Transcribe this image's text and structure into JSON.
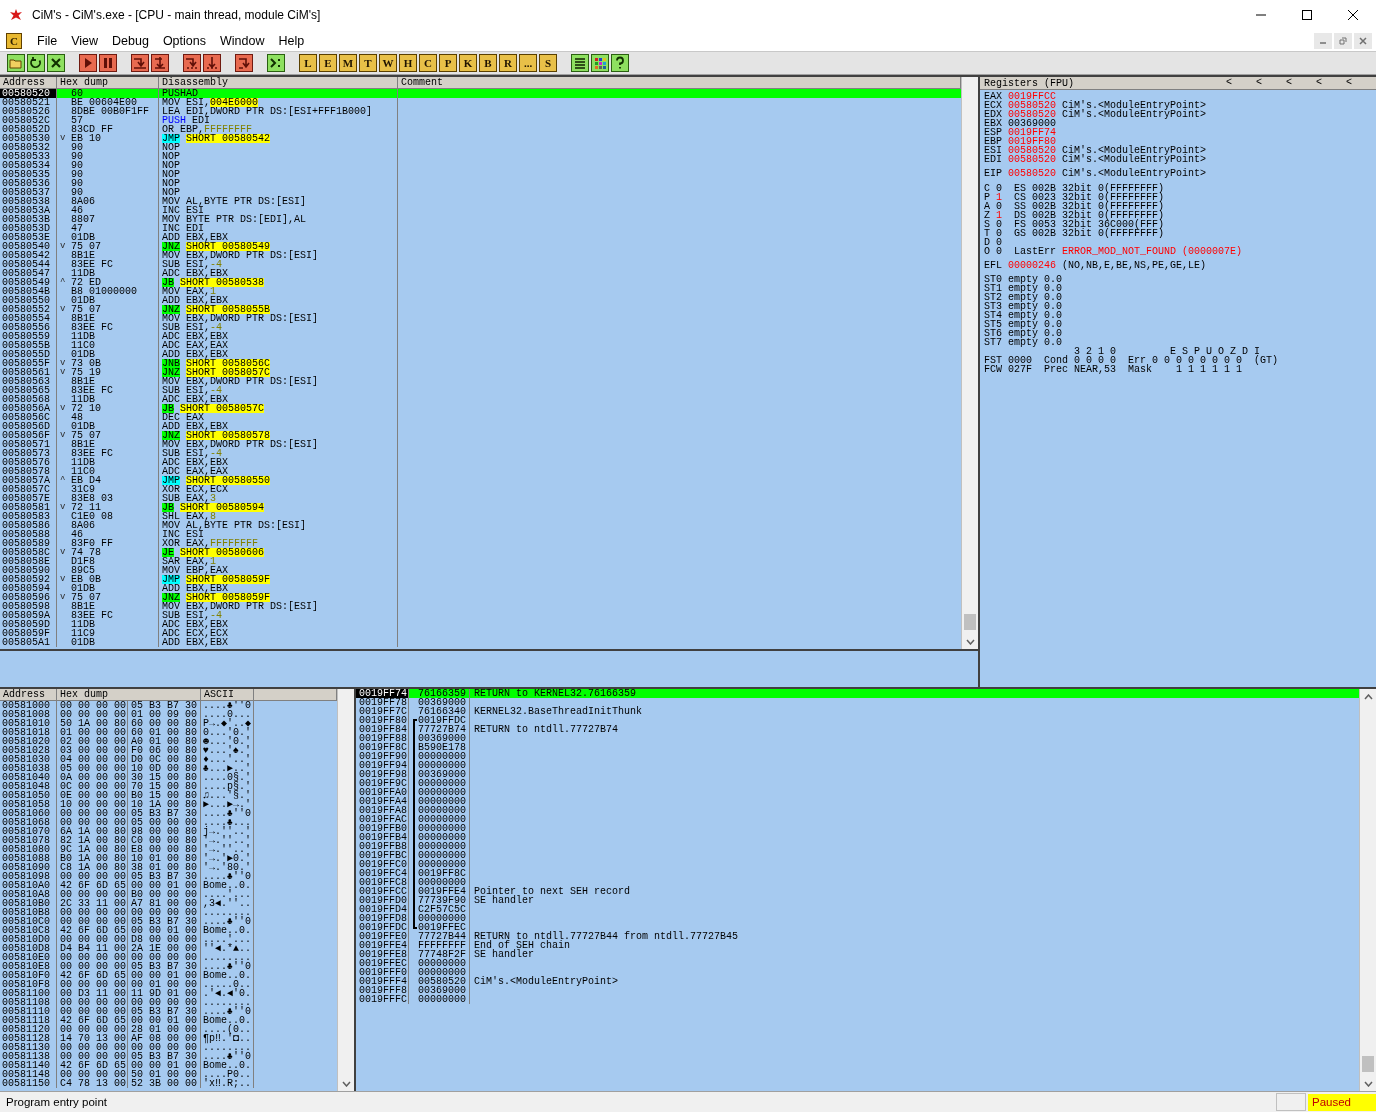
{
  "window": {
    "title": "CiM's - CiM's.exe - [CPU - main thread, module CiM's]"
  },
  "menu": {
    "app_letter": "C",
    "items": [
      "File",
      "View",
      "Debug",
      "Options",
      "Window",
      "Help"
    ]
  },
  "toolbar": {
    "window_buttons": [
      "L",
      "E",
      "M",
      "T",
      "W",
      "H",
      "C",
      "P",
      "K",
      "B",
      "R",
      "...",
      "S"
    ]
  },
  "disassembly": {
    "columns": [
      "Address",
      "Hex dump",
      "Disassembly",
      "Comment"
    ],
    "rows": [
      {
        "kind": "plain",
        "address": "00580520",
        "hex": "60",
        "op": "PUSHAD",
        "selected": true
      },
      {
        "kind": "plain",
        "address": "00580521",
        "hex": "BE 00604E00",
        "op": "MOV",
        "operands": "ESI,",
        "value": {
          "text": "004E6000",
          "kind": "address"
        },
        "selected": false
      },
      {
        "kind": "plain",
        "address": "00580526",
        "hex": "8DBE 00B0F1FF",
        "op": "LEA",
        "operands": "EDI,DWORD PTR DS:[ESI+FFF1B000]",
        "selected": false
      },
      {
        "kind": "push",
        "address": "0058052C",
        "hex": "57",
        "op": "PUSH",
        "operands": "EDI",
        "selected": false
      },
      {
        "kind": "plain",
        "address": "0058052D",
        "hex": "83CD FF",
        "op": "OR",
        "operands": "EBP,",
        "value": {
          "text": "FFFFFFFF",
          "kind": "constant"
        },
        "selected": false
      },
      {
        "kind": "jump",
        "address": "00580530",
        "arrow": "v",
        "hex": "EB 10",
        "op": "JMP",
        "value": {
          "text": "SHORT 00580542",
          "kind": "target"
        },
        "selected": false
      },
      {
        "kind": "plain",
        "address": "00580532",
        "hex": "90",
        "op": "NOP",
        "selected": false
      },
      {
        "kind": "plain",
        "address": "00580533",
        "hex": "90",
        "op": "NOP",
        "selected": false
      },
      {
        "kind": "plain",
        "address": "00580534",
        "hex": "90",
        "op": "NOP",
        "selected": false
      },
      {
        "kind": "plain",
        "address": "00580535",
        "hex": "90",
        "op": "NOP",
        "selected": false
      },
      {
        "kind": "plain",
        "address": "00580536",
        "hex": "90",
        "op": "NOP",
        "selected": false
      },
      {
        "kind": "plain",
        "address": "00580537",
        "hex": "90",
        "op": "NOP",
        "selected": false
      },
      {
        "kind": "plain",
        "address": "00580538",
        "hex": "8A06",
        "op": "MOV",
        "operands": "AL,BYTE PTR DS:[ESI]",
        "selected": false
      },
      {
        "kind": "plain",
        "address": "0058053A",
        "hex": "46",
        "op": "INC",
        "operands": "ESI",
        "selected": false
      },
      {
        "kind": "plain",
        "address": "0058053B",
        "hex": "8807",
        "op": "MOV",
        "operands": "BYTE PTR DS:[EDI],AL",
        "selected": false
      },
      {
        "kind": "plain",
        "address": "0058053D",
        "hex": "47",
        "op": "INC",
        "operands": "EDI",
        "selected": false
      },
      {
        "kind": "plain",
        "address": "0058053E",
        "hex": "01DB",
        "op": "ADD",
        "operands": "EBX,EBX",
        "selected": false
      },
      {
        "kind": "branch",
        "address": "00580540",
        "arrow": "v",
        "hex": "75 07",
        "op": "JNZ",
        "value": {
          "text": "SHORT 00580549",
          "kind": "target"
        },
        "selected": false
      },
      {
        "kind": "plain",
        "address": "00580542",
        "hex": "8B1E",
        "op": "MOV",
        "operands": "EBX,DWORD PTR DS:[ESI]",
        "selected": false
      },
      {
        "kind": "plain",
        "address": "00580544",
        "hex": "83EE FC",
        "op": "SUB",
        "operands": "ESI,",
        "value": {
          "text": "-4",
          "kind": "constant"
        },
        "selected": false
      },
      {
        "kind": "plain",
        "address": "00580547",
        "hex": "11DB",
        "op": "ADC",
        "operands": "EBX,EBX",
        "selected": false
      },
      {
        "kind": "branch",
        "address": "00580549",
        "arrow": "^",
        "hex": "72 ED",
        "op": "JB",
        "value": {
          "text": "SHORT 00580538",
          "kind": "target"
        },
        "selected": false
      },
      {
        "kind": "plain",
        "address": "0058054B",
        "hex": "B8 01000000",
        "op": "MOV",
        "operands": "EAX,",
        "value": {
          "text": "1",
          "kind": "constant"
        },
        "selected": false
      },
      {
        "kind": "plain",
        "address": "00580550",
        "hex": "01DB",
        "op": "ADD",
        "operands": "EBX,EBX",
        "selected": false
      },
      {
        "kind": "branch",
        "address": "00580552",
        "arrow": "v",
        "hex": "75 07",
        "op": "JNZ",
        "value": {
          "text": "SHORT 0058055B",
          "kind": "target"
        },
        "selected": false
      },
      {
        "kind": "plain",
        "address": "00580554",
        "hex": "8B1E",
        "op": "MOV",
        "operands": "EBX,DWORD PTR DS:[ESI]",
        "selected": false
      },
      {
        "kind": "plain",
        "address": "00580556",
        "hex": "83EE FC",
        "op": "SUB",
        "operands": "ESI,",
        "value": {
          "text": "-4",
          "kind": "constant"
        },
        "selected": false
      },
      {
        "kind": "plain",
        "address": "00580559",
        "hex": "11DB",
        "op": "ADC",
        "operands": "EBX,EBX",
        "selected": false
      },
      {
        "kind": "plain",
        "address": "0058055B",
        "hex": "11C0",
        "op": "ADC",
        "operands": "EAX,EAX",
        "selected": false
      },
      {
        "kind": "plain",
        "address": "0058055D",
        "hex": "01DB",
        "op": "ADD",
        "operands": "EBX,EBX",
        "selected": false
      },
      {
        "kind": "branch",
        "address": "0058055F",
        "arrow": "v",
        "hex": "73 0B",
        "op": "JNB",
        "value": {
          "text": "SHORT 0058056C",
          "kind": "target"
        },
        "selected": false
      },
      {
        "kind": "branch",
        "address": "00580561",
        "arrow": "v",
        "hex": "75 19",
        "op": "JNZ",
        "value": {
          "text": "SHORT 0058057C",
          "kind": "target"
        },
        "selected": false
      },
      {
        "kind": "plain",
        "address": "00580563",
        "hex": "8B1E",
        "op": "MOV",
        "operands": "EBX,DWORD PTR DS:[ESI]",
        "selected": false
      },
      {
        "kind": "plain",
        "address": "00580565",
        "hex": "83EE FC",
        "op": "SUB",
        "operands": "ESI,",
        "value": {
          "text": "-4",
          "kind": "constant"
        },
        "selected": false
      },
      {
        "kind": "plain",
        "address": "00580568",
        "hex": "11DB",
        "op": "ADC",
        "operands": "EBX,EBX",
        "selected": false
      },
      {
        "kind": "branch",
        "address": "0058056A",
        "arrow": "v",
        "hex": "72 10",
        "op": "JB",
        "value": {
          "text": "SHORT 0058057C",
          "kind": "target"
        },
        "selected": false
      },
      {
        "kind": "plain",
        "address": "0058056C",
        "hex": "48",
        "op": "DEC",
        "operands": "EAX",
        "selected": false
      },
      {
        "kind": "plain",
        "address": "0058056D",
        "hex": "01DB",
        "op": "ADD",
        "operands": "EBX,EBX",
        "selected": false
      },
      {
        "kind": "branch",
        "address": "0058056F",
        "arrow": "v",
        "hex": "75 07",
        "op": "JNZ",
        "value": {
          "text": "SHORT 00580578",
          "kind": "target"
        },
        "selected": false
      },
      {
        "kind": "plain",
        "address": "00580571",
        "hex": "8B1E",
        "op": "MOV",
        "operands": "EBX,DWORD PTR DS:[ESI]",
        "selected": false
      },
      {
        "kind": "plain",
        "address": "00580573",
        "hex": "83EE FC",
        "op": "SUB",
        "operands": "ESI,",
        "value": {
          "text": "-4",
          "kind": "constant"
        },
        "selected": false
      },
      {
        "kind": "plain",
        "address": "00580576",
        "hex": "11DB",
        "op": "ADC",
        "operands": "EBX,EBX",
        "selected": false
      },
      {
        "kind": "plain",
        "address": "00580578",
        "hex": "11C0",
        "op": "ADC",
        "operands": "EAX,EAX",
        "selected": false
      },
      {
        "kind": "jump",
        "address": "0058057A",
        "arrow": "^",
        "hex": "EB D4",
        "op": "JMP",
        "value": {
          "text": "SHORT 00580550",
          "kind": "target"
        },
        "selected": false
      },
      {
        "kind": "plain",
        "address": "0058057C",
        "hex": "31C9",
        "op": "XOR",
        "operands": "ECX,ECX",
        "selected": false
      },
      {
        "kind": "plain",
        "address": "0058057E",
        "hex": "83E8 03",
        "op": "SUB",
        "operands": "EAX,",
        "value": {
          "text": "3",
          "kind": "constant"
        },
        "selected": false
      },
      {
        "kind": "branch",
        "address": "00580581",
        "arrow": "v",
        "hex": "72 11",
        "op": "JB",
        "value": {
          "text": "SHORT 00580594",
          "kind": "target"
        },
        "selected": false
      },
      {
        "kind": "plain",
        "address": "00580583",
        "hex": "C1E0 08",
        "op": "SHL",
        "operands": "EAX,",
        "value": {
          "text": "8",
          "kind": "constant"
        },
        "selected": false
      },
      {
        "kind": "plain",
        "address": "00580586",
        "hex": "8A06",
        "op": "MOV",
        "operands": "AL,BYTE PTR DS:[ESI]",
        "selected": false
      },
      {
        "kind": "plain",
        "address": "00580588",
        "hex": "46",
        "op": "INC",
        "operands": "ESI",
        "selected": false
      },
      {
        "kind": "plain",
        "address": "00580589",
        "hex": "83F0 FF",
        "op": "XOR",
        "operands": "EAX,",
        "value": {
          "text": "FFFFFFFF",
          "kind": "constant"
        },
        "selected": false
      },
      {
        "kind": "branch",
        "address": "0058058C",
        "arrow": "v",
        "hex": "74 78",
        "op": "JE",
        "value": {
          "text": "SHORT 00580606",
          "kind": "target"
        },
        "selected": false
      },
      {
        "kind": "plain",
        "address": "0058058E",
        "hex": "D1F8",
        "op": "SAR",
        "operands": "EAX,",
        "value": {
          "text": "1",
          "kind": "constant"
        },
        "selected": false
      },
      {
        "kind": "plain",
        "address": "00580590",
        "hex": "89C5",
        "op": "MOV",
        "operands": "EBP,EAX",
        "selected": false
      },
      {
        "kind": "jump",
        "address": "00580592",
        "arrow": "v",
        "hex": "EB 0B",
        "op": "JMP",
        "value": {
          "text": "SHORT 0058059F",
          "kind": "target"
        },
        "selected": false
      },
      {
        "kind": "plain",
        "address": "00580594",
        "hex": "01DB",
        "op": "ADD",
        "operands": "EBX,EBX",
        "selected": false
      },
      {
        "kind": "branch",
        "address": "00580596",
        "arrow": "v",
        "hex": "75 07",
        "op": "JNZ",
        "value": {
          "text": "SHORT 0058059F",
          "kind": "target"
        },
        "selected": false
      },
      {
        "kind": "plain",
        "address": "00580598",
        "hex": "8B1E",
        "op": "MOV",
        "operands": "EBX,DWORD PTR DS:[ESI]",
        "selected": false
      },
      {
        "kind": "plain",
        "address": "0058059A",
        "hex": "83EE FC",
        "op": "SUB",
        "operands": "ESI,",
        "value": {
          "text": "-4",
          "kind": "constant"
        },
        "selected": false
      },
      {
        "kind": "plain",
        "address": "0058059D",
        "hex": "11DB",
        "op": "ADC",
        "operands": "EBX,EBX",
        "selected": false
      },
      {
        "kind": "plain",
        "address": "0058059F",
        "hex": "11C9",
        "op": "ADC",
        "operands": "ECX,ECX",
        "selected": false
      },
      {
        "kind": "plain",
        "address": "005805A1",
        "hex": "01DB",
        "op": "ADD",
        "operands": "EBX,EBX",
        "selected": false
      }
    ]
  },
  "registers": {
    "title": "Registers (FPU)",
    "nav": [
      "<",
      "<",
      "<",
      "<",
      "<"
    ],
    "general": [
      {
        "name": "EAX",
        "value": "0019FFCC",
        "changed": true
      },
      {
        "name": "ECX",
        "value": "00580520",
        "changed": true,
        "comment": "CiM's.<ModuleEntryPoint>"
      },
      {
        "name": "EDX",
        "value": "00580520",
        "changed": true,
        "comment": "CiM's.<ModuleEntryPoint>"
      },
      {
        "name": "EBX",
        "value": "00369000",
        "changed": false
      },
      {
        "name": "ESP",
        "value": "0019FF74",
        "changed": true
      },
      {
        "name": "EBP",
        "value": "0019FF80",
        "changed": true
      },
      {
        "name": "ESI",
        "value": "00580520",
        "changed": true,
        "comment": "CiM's.<ModuleEntryPoint>"
      },
      {
        "name": "EDI",
        "value": "00580520",
        "changed": true,
        "comment": "CiM's.<ModuleEntryPoint>"
      }
    ],
    "eip": {
      "name": "EIP",
      "value": "00580520",
      "changed": true,
      "comment": "CiM's.<ModuleEntryPoint>"
    },
    "flags": [
      {
        "name": "C",
        "value": "0",
        "changed": false,
        "segment": "ES 002B 32bit 0(FFFFFFFF)"
      },
      {
        "name": "P",
        "value": "1",
        "changed": true,
        "segment": "CS 0023 32bit 0(FFFFFFFF)"
      },
      {
        "name": "A",
        "value": "0",
        "changed": false,
        "segment": "SS 002B 32bit 0(FFFFFFFF)"
      },
      {
        "name": "Z",
        "value": "1",
        "changed": true,
        "segment": "DS 002B 32bit 0(FFFFFFFF)"
      },
      {
        "name": "S",
        "value": "0",
        "changed": false,
        "segment": "FS 0053 32bit 36C000(FFF)"
      },
      {
        "name": "T",
        "value": "0",
        "changed": false,
        "segment": "GS 002B 32bit 0(FFFFFFFF)"
      },
      {
        "name": "D",
        "value": "0",
        "changed": false
      },
      {
        "name": "O",
        "value": "0",
        "changed": false,
        "label": "LastErr",
        "error": "ERROR_MOD_NOT_FOUND (0000007E)"
      }
    ],
    "efl": {
      "name": "EFL",
      "value": "00000246",
      "changed": true,
      "decoded": "(NO,NB,E,BE,NS,PE,GE,LE)"
    },
    "fpu": [
      {
        "name": "ST0",
        "tag": "empty",
        "value": "0.0"
      },
      {
        "name": "ST1",
        "tag": "empty",
        "value": "0.0"
      },
      {
        "name": "ST2",
        "tag": "empty",
        "value": "0.0"
      },
      {
        "name": "ST3",
        "tag": "empty",
        "value": "0.0"
      },
      {
        "name": "ST4",
        "tag": "empty",
        "value": "0.0"
      },
      {
        "name": "ST5",
        "tag": "empty",
        "value": "0.0"
      },
      {
        "name": "ST6",
        "tag": "empty",
        "value": "0.0"
      },
      {
        "name": "ST7",
        "tag": "empty",
        "value": "0.0"
      }
    ],
    "fpu_bits": {
      "cond": "3 2 1 0",
      "err": "E S P U O Z D I"
    },
    "fpu_lines": [
      "FST 0000  Cond 0 0 0 0  Err 0 0 0 0 0 0 0 0  (GT)",
      "FCW 027F  Prec NEAR,53  Mask    1 1 1 1 1 1"
    ]
  },
  "dump": {
    "columns": [
      "Address",
      "Hex dump",
      "ASCII"
    ],
    "rows": [
      {
        "address": "00581000",
        "hex": [
          "00 00 00 00",
          "05 B3 B7 30"
        ],
        "ascii": "....♣''0"
      },
      {
        "address": "00581008",
        "hex": [
          "00 00 00 00",
          "01 00 09 00"
        ],
        "ascii": "....0..."
      },
      {
        "address": "00581010",
        "hex": [
          "50 1A 00 80",
          "60 00 00 80"
        ],
        "ascii": "P→.◆'..◆"
      },
      {
        "address": "00581018",
        "hex": [
          "01 00 00 00",
          "60 01 00 80"
        ],
        "ascii": "0...'0.'"
      },
      {
        "address": "00581020",
        "hex": [
          "02 00 00 00",
          "A0 01 00 80"
        ],
        "ascii": "☻...'0.'"
      },
      {
        "address": "00581028",
        "hex": [
          "03 00 00 00",
          "F0 06 00 80"
        ],
        "ascii": "♥...'♠.'"
      },
      {
        "address": "00581030",
        "hex": [
          "04 00 00 00",
          "D0 0C 00 80"
        ],
        "ascii": "♦...'..'"
      },
      {
        "address": "00581038",
        "hex": [
          "05 00 00 00",
          "10 0D 00 80"
        ],
        "ascii": "♣...►..'"
      },
      {
        "address": "00581040",
        "hex": [
          "0A 00 00 00",
          "30 15 00 80"
        ],
        "ascii": "....0§.'"
      },
      {
        "address": "00581048",
        "hex": [
          "0C 00 00 00",
          "70 15 00 80"
        ],
        "ascii": "....p§.'"
      },
      {
        "address": "00581050",
        "hex": [
          "0E 00 00 00",
          "B0 15 00 80"
        ],
        "ascii": "♫...'§.'"
      },
      {
        "address": "00581058",
        "hex": [
          "10 00 00 00",
          "10 1A 00 80"
        ],
        "ascii": "►...►→.'"
      },
      {
        "address": "00581060",
        "hex": [
          "00 00 00 00",
          "05 B3 B7 30"
        ],
        "ascii": "....♣''0"
      },
      {
        "address": "00581068",
        "hex": [
          "00 00 00 00",
          "05 00 00 00"
        ],
        "ascii": "....♣..."
      },
      {
        "address": "00581070",
        "hex": [
          "6A 1A 00 80",
          "98 00 00 80"
        ],
        "ascii": "j→.''..'"
      },
      {
        "address": "00581078",
        "hex": [
          "82 1A 00 80",
          "C0 00 00 80"
        ],
        "ascii": "'→.''..'"
      },
      {
        "address": "00581080",
        "hex": [
          "9C 1A 00 80",
          "E8 00 00 80"
        ],
        "ascii": "'→.''..'"
      },
      {
        "address": "00581088",
        "hex": [
          "B0 1A 00 80",
          "10 01 00 80"
        ],
        "ascii": "'→.'►0.'"
      },
      {
        "address": "00581090",
        "hex": [
          "C8 1A 00 80",
          "38 01 00 80"
        ],
        "ascii": "'→.'80.'"
      },
      {
        "address": "00581098",
        "hex": [
          "00 00 00 00",
          "05 B3 B7 30"
        ],
        "ascii": "....♣''0"
      },
      {
        "address": "005810A0",
        "hex": [
          "42 6F 6D 65",
          "00 00 01 00"
        ],
        "ascii": "Bome..0."
      },
      {
        "address": "005810A8",
        "hex": [
          "00 00 00 00",
          "B0 00 00 00"
        ],
        "ascii": "....'..."
      },
      {
        "address": "005810B0",
        "hex": [
          "2C 33 11 00",
          "A7 81 00 00"
        ],
        "ascii": ",3◄.''.."
      },
      {
        "address": "005810B8",
        "hex": [
          "00 00 00 00",
          "00 00 00 00"
        ],
        "ascii": "........"
      },
      {
        "address": "005810C0",
        "hex": [
          "00 00 00 00",
          "05 B3 B7 30"
        ],
        "ascii": "....♣''0"
      },
      {
        "address": "005810C8",
        "hex": [
          "42 6F 6D 65",
          "00 00 01 00"
        ],
        "ascii": "Bome..0."
      },
      {
        "address": "005810D0",
        "hex": [
          "00 00 00 00",
          "D8 00 00 00"
        ],
        "ascii": "....'..."
      },
      {
        "address": "005810D8",
        "hex": [
          "D4 B4 11 00",
          "2A 1E 00 00"
        ],
        "ascii": "''◄.*▲.."
      },
      {
        "address": "005810E0",
        "hex": [
          "00 00 00 00",
          "00 00 00 00"
        ],
        "ascii": "........"
      },
      {
        "address": "005810E8",
        "hex": [
          "00 00 00 00",
          "05 B3 B7 30"
        ],
        "ascii": "....♣''0"
      },
      {
        "address": "005810F0",
        "hex": [
          "42 6F 6D 65",
          "00 00 01 00"
        ],
        "ascii": "Bome..0."
      },
      {
        "address": "005810F8",
        "hex": [
          "00 00 00 00",
          "00 01 00 00"
        ],
        "ascii": ".....0.."
      },
      {
        "address": "00581100",
        "hex": [
          "00 D3 11 00",
          "11 9D 01 00"
        ],
        "ascii": ".'◄.◄'0."
      },
      {
        "address": "00581108",
        "hex": [
          "00 00 00 00",
          "00 00 00 00"
        ],
        "ascii": "........"
      },
      {
        "address": "00581110",
        "hex": [
          "00 00 00 00",
          "05 B3 B7 30"
        ],
        "ascii": "....♣''0"
      },
      {
        "address": "00581118",
        "hex": [
          "42 6F 6D 65",
          "00 00 01 00"
        ],
        "ascii": "Bome..0."
      },
      {
        "address": "00581120",
        "hex": [
          "00 00 00 00",
          "28 01 00 00"
        ],
        "ascii": "....(0.."
      },
      {
        "address": "00581128",
        "hex": [
          "14 70 13 00",
          "AF 08 00 00"
        ],
        "ascii": "¶p‼.'◘.."
      },
      {
        "address": "00581130",
        "hex": [
          "00 00 00 00",
          "00 00 00 00"
        ],
        "ascii": "........"
      },
      {
        "address": "00581138",
        "hex": [
          "00 00 00 00",
          "05 B3 B7 30"
        ],
        "ascii": "....♣''0"
      },
      {
        "address": "00581140",
        "hex": [
          "42 6F 6D 65",
          "00 00 01 00"
        ],
        "ascii": "Bome..0."
      },
      {
        "address": "00581148",
        "hex": [
          "00 00 00 00",
          "50 01 00 00"
        ],
        "ascii": "....P0.."
      },
      {
        "address": "00581150",
        "hex": [
          "C4 78 13 00",
          "52 3B 00 00"
        ],
        "ascii": "'x‼.R;.."
      }
    ]
  },
  "stack": {
    "rows": [
      {
        "address": "0019FF74",
        "value": "76166359",
        "comment": "RETURN to KERNEL32.76166359",
        "selected": true
      },
      {
        "address": "0019FF78",
        "value": "00369000",
        "selected": false
      },
      {
        "address": "0019FF7C",
        "value": "76166340",
        "comment": "KERNEL32.BaseThreadInitThunk",
        "selected": false
      },
      {
        "address": "0019FF80",
        "value": "0019FFDC",
        "kind": "frame_top",
        "selected": false
      },
      {
        "address": "0019FF84",
        "value": "77727B74",
        "comment": "RETURN to ntdll.77727B74",
        "selected": false
      },
      {
        "address": "0019FF88",
        "value": "00369000",
        "selected": false
      },
      {
        "address": "0019FF8C",
        "value": "B590E178",
        "selected": false
      },
      {
        "address": "0019FF90",
        "value": "00000000",
        "selected": false
      },
      {
        "address": "0019FF94",
        "value": "00000000",
        "selected": false
      },
      {
        "address": "0019FF98",
        "value": "00369000",
        "selected": false
      },
      {
        "address": "0019FF9C",
        "value": "00000000",
        "selected": false
      },
      {
        "address": "0019FFA0",
        "value": "00000000",
        "selected": false
      },
      {
        "address": "0019FFA4",
        "value": "00000000",
        "selected": false
      },
      {
        "address": "0019FFA8",
        "value": "00000000",
        "selected": false
      },
      {
        "address": "0019FFAC",
        "value": "00000000",
        "selected": false
      },
      {
        "address": "0019FFB0",
        "value": "00000000",
        "selected": false
      },
      {
        "address": "0019FFB4",
        "value": "00000000",
        "selected": false
      },
      {
        "address": "0019FFB8",
        "value": "00000000",
        "selected": false
      },
      {
        "address": "0019FFBC",
        "value": "00000000",
        "selected": false
      },
      {
        "address": "0019FFC0",
        "value": "00000000",
        "selected": false
      },
      {
        "address": "0019FFC4",
        "value": "0019FF8C",
        "selected": false
      },
      {
        "address": "0019FFC8",
        "value": "00000000",
        "selected": false
      },
      {
        "address": "0019FFCC",
        "value": "0019FFE4",
        "comment": "Pointer to next SEH record",
        "selected": false
      },
      {
        "address": "0019FFD0",
        "value": "77739F90",
        "comment": "SE handler",
        "selected": false
      },
      {
        "address": "0019FFD4",
        "value": "C2F57C5C",
        "selected": false
      },
      {
        "address": "0019FFD8",
        "value": "00000000",
        "selected": false
      },
      {
        "address": "0019FFDC",
        "value": "0019FFEC",
        "kind": "frame_bottom",
        "selected": false
      },
      {
        "address": "0019FFE0",
        "value": "77727B44",
        "comment": "RETURN to ntdll.77727B44 from ntdll.77727B45",
        "selected": false
      },
      {
        "address": "0019FFE4",
        "value": "FFFFFFFF",
        "comment": "End of SEH chain",
        "selected": false
      },
      {
        "address": "0019FFE8",
        "value": "77748F2F",
        "comment": "SE handler",
        "selected": false
      },
      {
        "address": "0019FFEC",
        "value": "00000000",
        "selected": false
      },
      {
        "address": "0019FFF0",
        "value": "00000000",
        "selected": false
      },
      {
        "address": "0019FFF4",
        "value": "00580520",
        "comment": "CiM's.<ModuleEntryPoint>",
        "selected": false
      },
      {
        "address": "0019FFF8",
        "value": "00369000",
        "selected": false
      },
      {
        "address": "0019FFFC",
        "value": "00000000",
        "selected": false
      }
    ]
  },
  "status_bar": {
    "message": "Program entry point",
    "state": "Paused"
  }
}
